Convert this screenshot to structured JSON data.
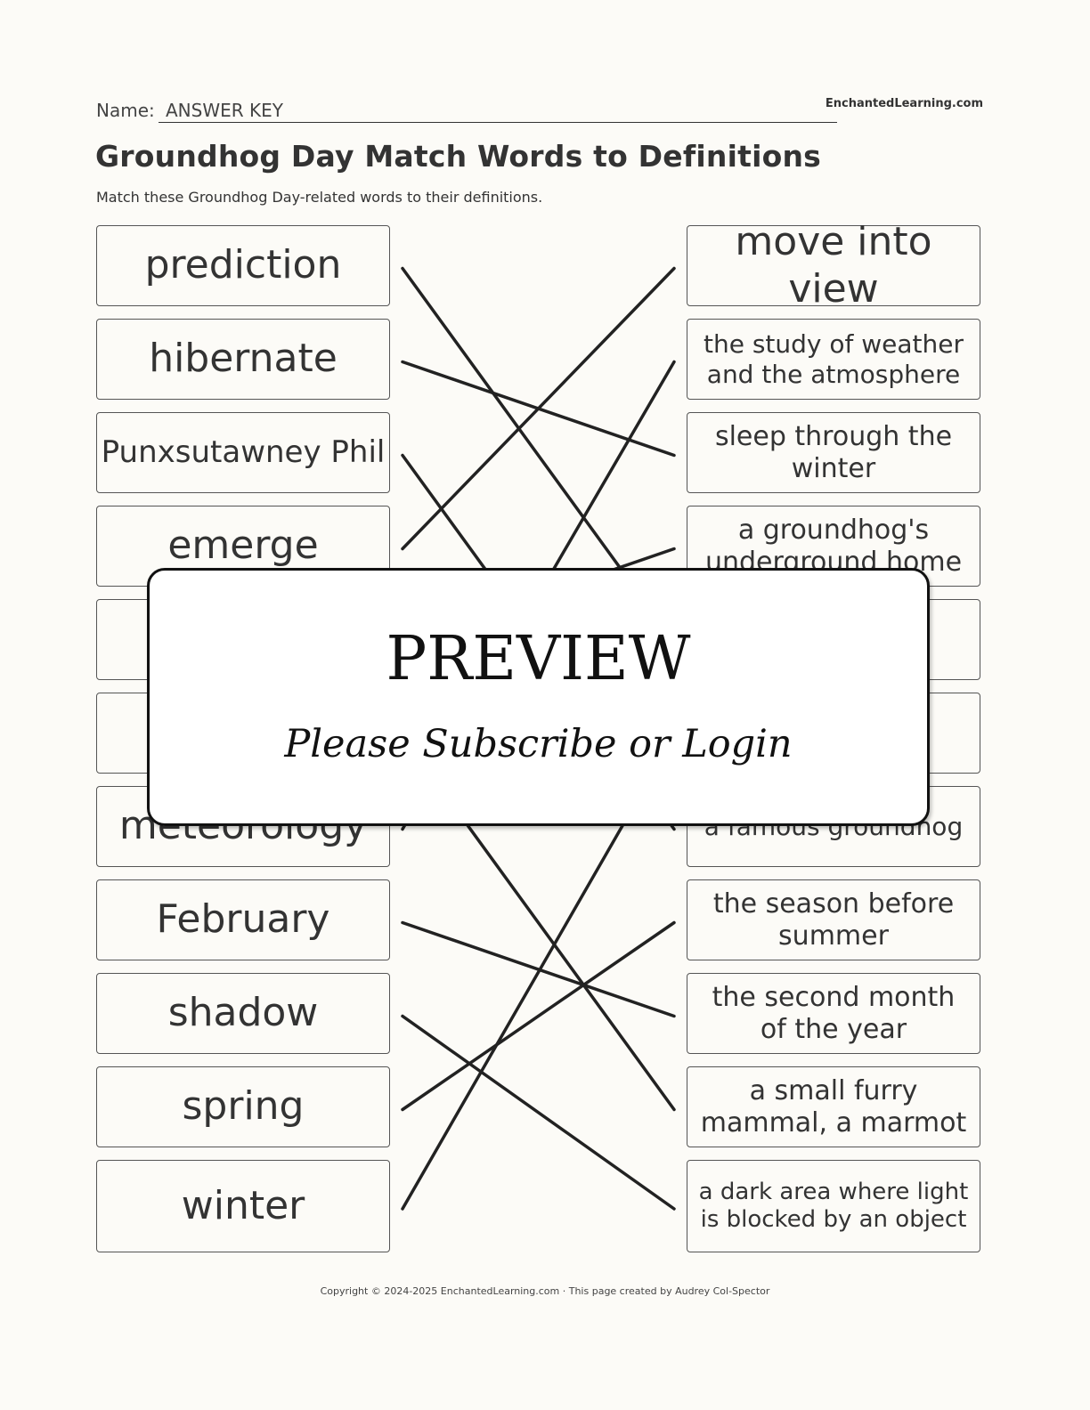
{
  "header": {
    "name_label": "Name:",
    "name_value": "ANSWER KEY",
    "brand": "EnchantedLearning.com",
    "title": "Groundhog Day Match Words to Definitions",
    "subtitle": "Match these Groundhog Day-related words to their definitions."
  },
  "words": [
    "prediction",
    "hibernate",
    "Punxsutawney Phil",
    "emerge",
    "",
    "",
    "meteorology",
    "February",
    "shadow",
    "spring",
    "winter"
  ],
  "definitions": [
    "move into view",
    "the study of weather and the atmosphere",
    "sleep through the winter",
    "a groundhog's underground home",
    "",
    "",
    "a famous groundhog",
    "the season before summer",
    "the second month of the year",
    "a small furry mammal, a marmot",
    "a dark area where light is blocked by an object"
  ],
  "matches": [
    [
      0,
      4
    ],
    [
      1,
      2
    ],
    [
      2,
      6
    ],
    [
      3,
      0
    ],
    [
      4,
      3
    ],
    [
      5,
      9
    ],
    [
      6,
      1
    ],
    [
      7,
      8
    ],
    [
      8,
      10
    ],
    [
      9,
      7
    ],
    [
      10,
      5
    ]
  ],
  "overlay": {
    "title": "PREVIEW",
    "subtitle": "Please Subscribe or Login"
  },
  "footer": "Copyright © 2024-2025 EnchantedLearning.com · This page created by Audrey Col-Spector"
}
